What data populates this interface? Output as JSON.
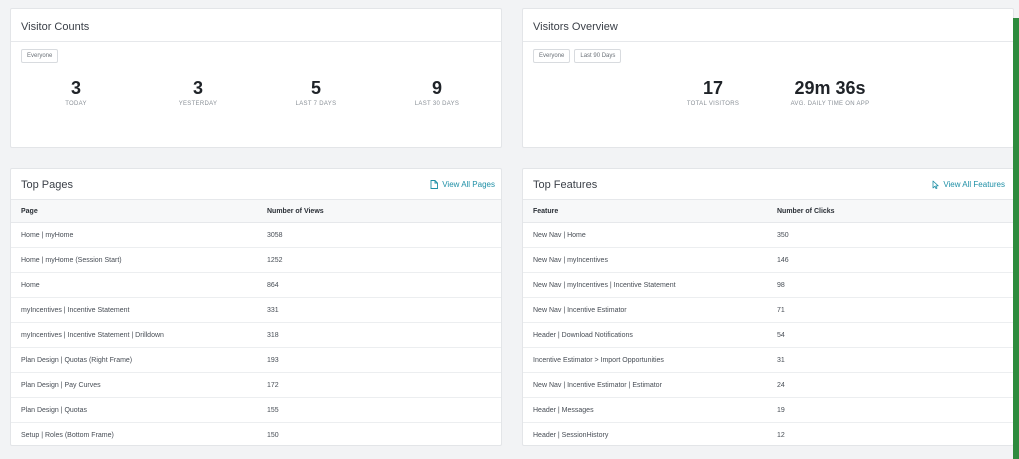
{
  "visitor_counts": {
    "title": "Visitor Counts",
    "segment_chip": "Everyone",
    "stats": [
      {
        "value": "3",
        "label": "TODAY"
      },
      {
        "value": "3",
        "label": "YESTERDAY"
      },
      {
        "value": "5",
        "label": "LAST 7 DAYS"
      },
      {
        "value": "9",
        "label": "LAST 30 DAYS"
      }
    ]
  },
  "visitors_overview": {
    "title": "Visitors Overview",
    "segment_chip": "Everyone",
    "range_chip": "Last 90 Days",
    "stats": [
      {
        "value": "17",
        "label": "TOTAL VISITORS"
      },
      {
        "value": "29m 36s",
        "label": "AVG. DAILY TIME ON APP"
      }
    ]
  },
  "top_pages": {
    "title": "Top Pages",
    "view_all_label": "View All Pages",
    "columns": [
      "Page",
      "Number of Views"
    ],
    "rows": [
      [
        "Home | myHome",
        "3058"
      ],
      [
        "Home | myHome (Session Start)",
        "1252"
      ],
      [
        "Home",
        "864"
      ],
      [
        "myIncentives | Incentive Statement",
        "331"
      ],
      [
        "myIncentives | Incentive Statement | Drilldown",
        "318"
      ],
      [
        "Plan Design | Quotas (Right Frame)",
        "193"
      ],
      [
        "Plan Design | Pay Curves",
        "172"
      ],
      [
        "Plan Design | Quotas",
        "155"
      ],
      [
        "Setup | Roles (Bottom Frame)",
        "150"
      ]
    ]
  },
  "top_features": {
    "title": "Top Features",
    "view_all_label": "View All Features",
    "columns": [
      "Feature",
      "Number of Clicks"
    ],
    "rows": [
      [
        "New Nav | Home",
        "350"
      ],
      [
        "New Nav | myIncentives",
        "146"
      ],
      [
        "New Nav | myIncentives | Incentive Statement",
        "98"
      ],
      [
        "New Nav | Incentive Estimator",
        "71"
      ],
      [
        "Header | Download Notifications",
        "54"
      ],
      [
        "Incentive Estimator > Import Opportunities",
        "31"
      ],
      [
        "New Nav | Incentive Estimator | Estimator",
        "24"
      ],
      [
        "Header | Messages",
        "19"
      ],
      [
        "Header | SessionHistory",
        "12"
      ]
    ]
  },
  "colors": {
    "accent": "#1e8fa6",
    "page_bg": "#f2f3f5",
    "edge_bar": "#2e8b3e"
  },
  "icons": {
    "view_all_pages": "document-icon",
    "view_all_features": "cursor-click-icon"
  }
}
